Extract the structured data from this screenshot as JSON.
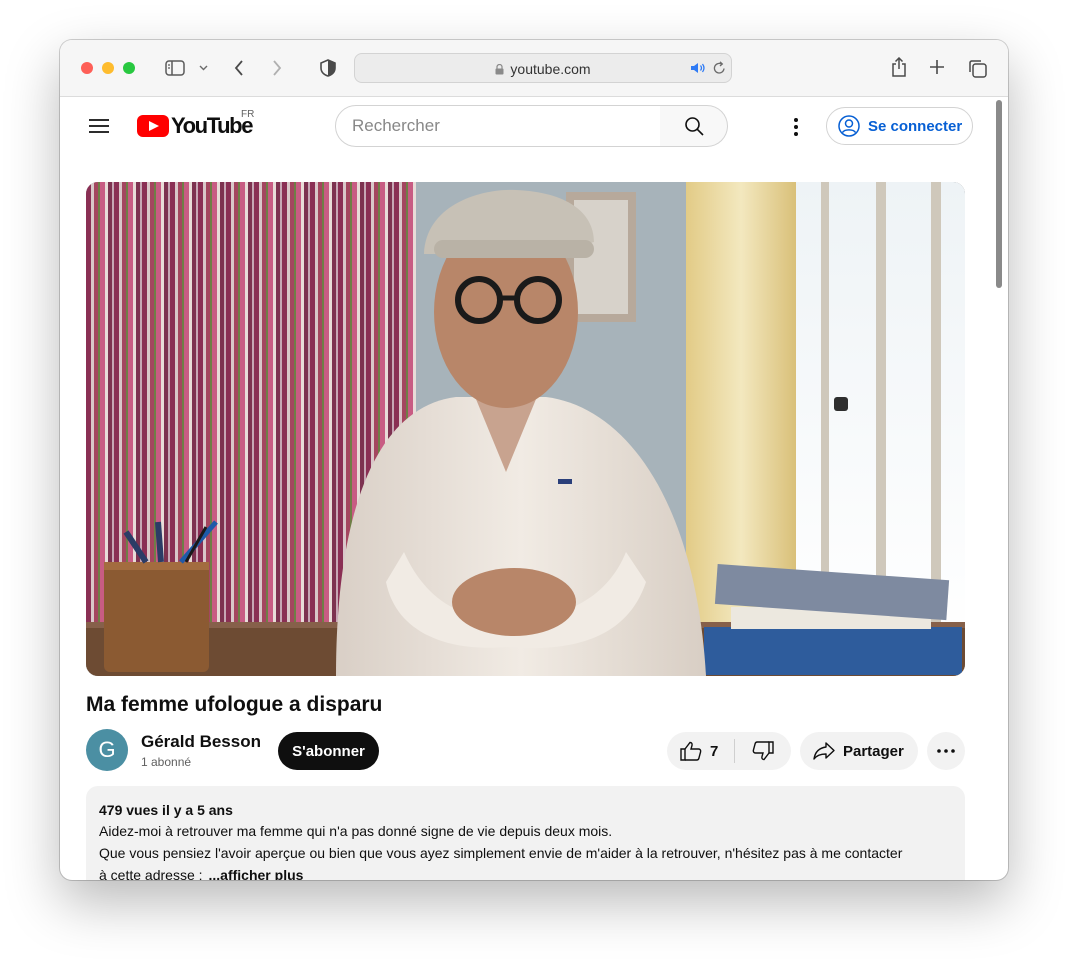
{
  "browser": {
    "url": "youtube.com"
  },
  "header": {
    "logo_text": "YouTube",
    "region": "FR",
    "search_placeholder": "Rechercher",
    "signin_label": "Se connecter"
  },
  "video": {
    "title": "Ma femme ufologue a disparu"
  },
  "channel": {
    "avatar_letter": "G",
    "name": "Gérald Besson",
    "subscribers": "1 abonné",
    "subscribe_label": "S'abonner"
  },
  "actions": {
    "likes": "7",
    "share_label": "Partager"
  },
  "description": {
    "meta": "479 vues  il y a 5 ans",
    "line1": "Aidez-moi à retrouver ma femme qui n'a pas donné signe de vie depuis deux mois.",
    "line2": "Que vous pensiez l'avoir aperçue ou bien que vous ayez simplement envie de m'aider à la retrouver, n'hésitez pas à me contacter",
    "line3": "à cette adresse :",
    "more_label": "...afficher plus"
  },
  "colors": {
    "accent_blue": "#065fd4",
    "brand_red": "#ff0000"
  }
}
